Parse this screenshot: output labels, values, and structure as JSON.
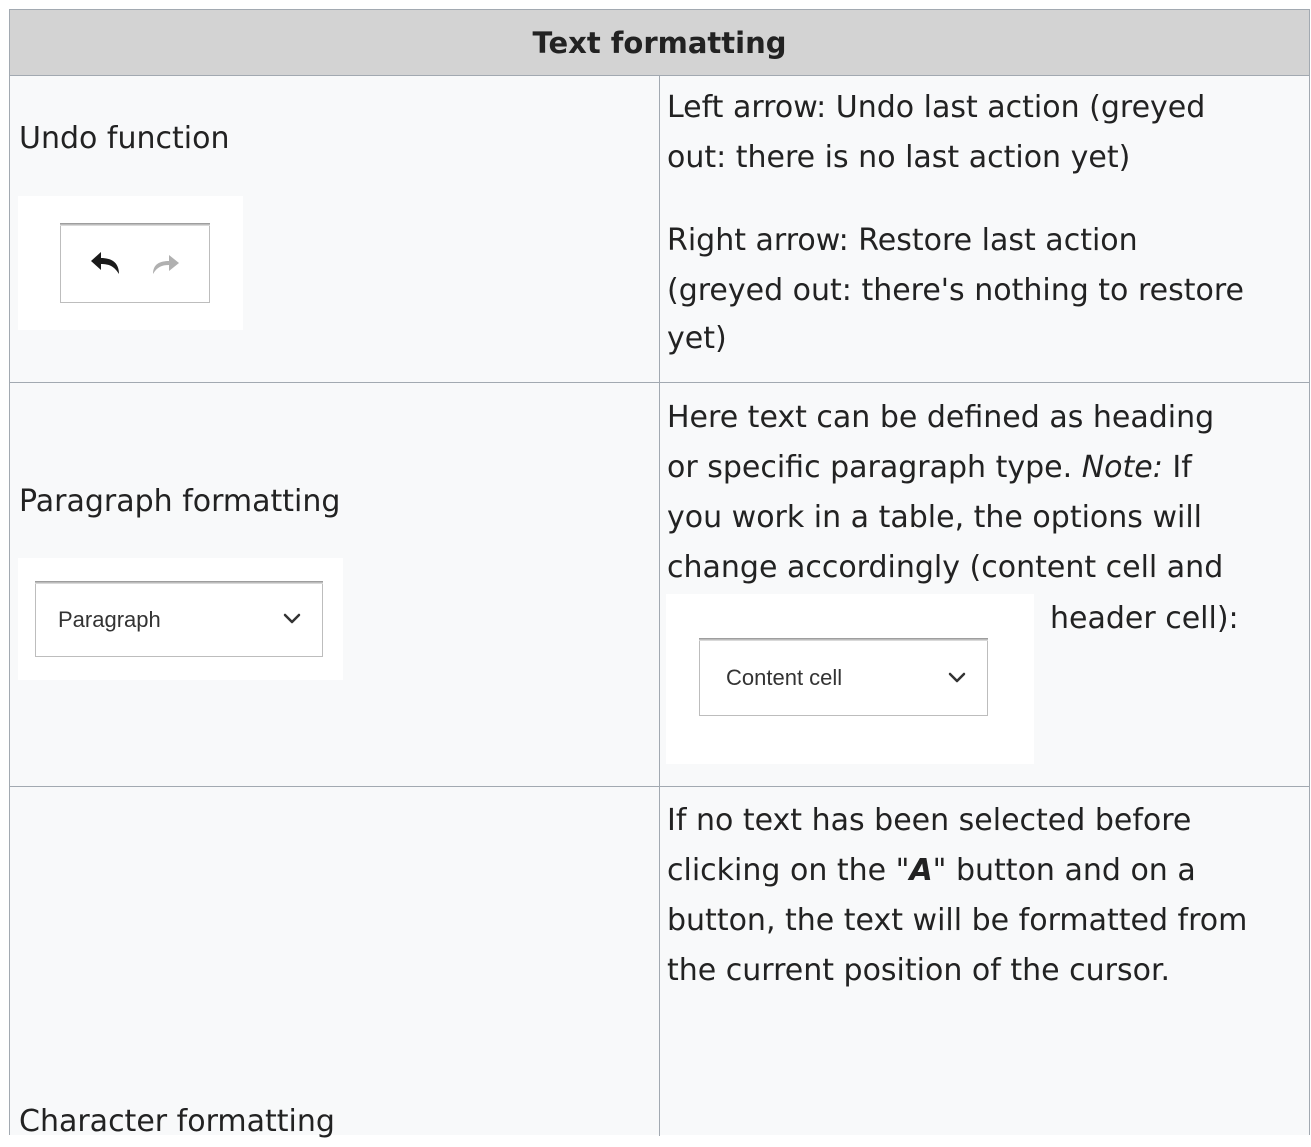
{
  "table": {
    "title": "Text formatting",
    "rows": [
      {
        "feature": "Undo function",
        "description_lines": [
          "Left arrow: Undo last action (greyed",
          "out: there is no last action yet)"
        ],
        "description2_lines": [
          "Right arrow: Restore last action",
          "(greyed out: there's nothing to restore",
          "yet)"
        ],
        "image": {
          "undo_icon": "undo-arrow-icon",
          "redo_icon": "redo-arrow-icon"
        }
      },
      {
        "feature": "Paragraph formatting",
        "description_lines": [
          "Here text can be defined as heading",
          "or specific paragraph type.",
          "Note:",
          "If",
          "you work in a table, the options will",
          "change accordingly (content cell and",
          "header cell):"
        ],
        "image": {
          "dropdown_label": "Paragraph",
          "dropdown_icon": "chevron-down-icon"
        },
        "table_image": {
          "dropdown_label": "Content cell",
          "dropdown_icon": "chevron-down-icon"
        }
      },
      {
        "feature": "Character formatting",
        "description_lines": [
          "If no text has been selected before",
          "clicking on the \"",
          "A",
          "\" button and on a",
          "button, the text will be formatted from",
          "the current position of the cursor."
        ]
      }
    ]
  },
  "colors": {
    "header_bg": "#d3d3d3",
    "cell_bg": "#f8f9fa",
    "border": "#a2a9b1",
    "text": "#222222"
  }
}
